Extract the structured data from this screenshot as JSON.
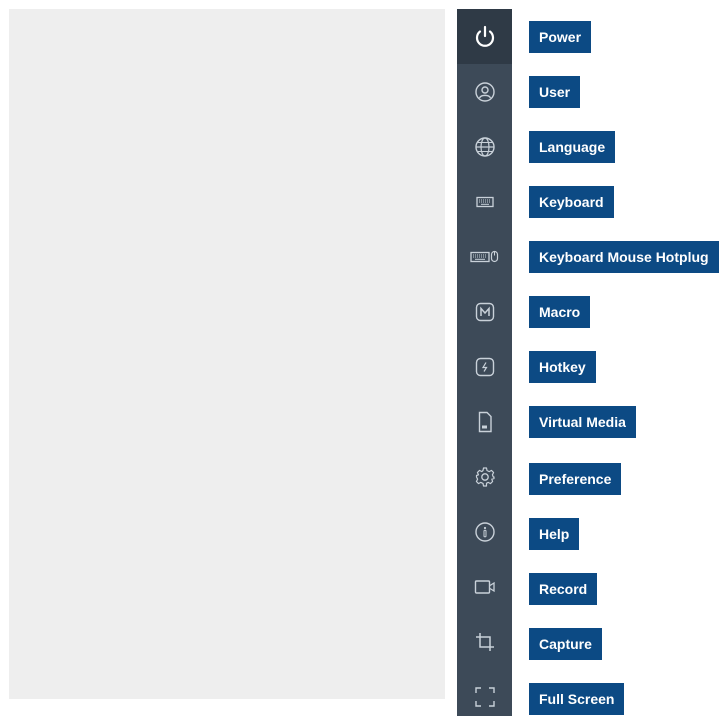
{
  "toolbar": {
    "items": [
      {
        "id": "power",
        "label": "Power",
        "icon": "power-icon"
      },
      {
        "id": "user",
        "label": "User",
        "icon": "user-icon"
      },
      {
        "id": "language",
        "label": "Language",
        "icon": "globe-icon"
      },
      {
        "id": "keyboard",
        "label": "Keyboard",
        "icon": "keyboard-icon"
      },
      {
        "id": "keyboard-mouse-hotplug",
        "label": "Keyboard Mouse Hotplug",
        "icon": "keyboard-mouse-icon"
      },
      {
        "id": "macro",
        "label": "Macro",
        "icon": "macro-icon"
      },
      {
        "id": "hotkey",
        "label": "Hotkey",
        "icon": "hotkey-icon"
      },
      {
        "id": "virtual-media",
        "label": "Virtual Media",
        "icon": "sd-card-icon"
      },
      {
        "id": "preference",
        "label": "Preference",
        "icon": "gear-icon"
      },
      {
        "id": "help",
        "label": "Help",
        "icon": "info-icon"
      },
      {
        "id": "record",
        "label": "Record",
        "icon": "video-camera-icon"
      },
      {
        "id": "capture",
        "label": "Capture",
        "icon": "crop-icon"
      },
      {
        "id": "full-screen",
        "label": "Full Screen",
        "icon": "fullscreen-icon"
      }
    ]
  },
  "colors": {
    "toolbar_bg": "#3d4a58",
    "label_bg": "#0c4a84",
    "viewer_bg": "#eeeeee",
    "icon": "#c9d1d9"
  }
}
